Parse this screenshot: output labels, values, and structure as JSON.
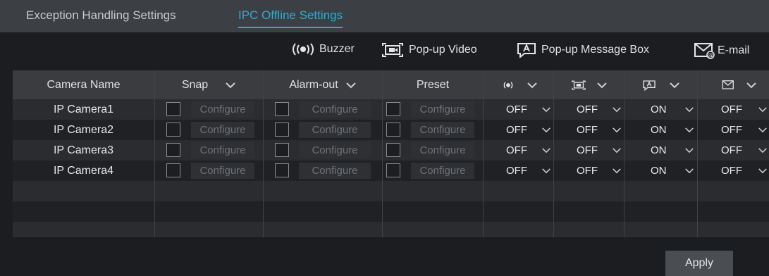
{
  "tabs": [
    {
      "label": "Exception Handling Settings",
      "active": false
    },
    {
      "label": "IPC Offline Settings",
      "active": true
    }
  ],
  "legend": {
    "buzzer": {
      "icon": "buzzer-icon",
      "label": "Buzzer"
    },
    "popup_video": {
      "icon": "popup-video-icon",
      "label": "Pop-up Video"
    },
    "popup_message": {
      "icon": "popup-message-icon",
      "label": "Pop-up Message Box"
    },
    "email": {
      "icon": "email-icon",
      "label": "E-mail"
    }
  },
  "table": {
    "headers": {
      "camera_name": "Camera Name",
      "snap": "Snap",
      "alarm_out": "Alarm-out",
      "preset": "Preset",
      "buzzer_icon": "buzzer-icon",
      "popup_video_icon": "popup-video-icon",
      "popup_message_icon": "popup-message-icon",
      "email_icon": "email-icon"
    },
    "configure_label": "Configure",
    "rows": [
      {
        "name": "IP Camera1",
        "buzzer": "OFF",
        "popup_video": "OFF",
        "popup_message": "ON",
        "email": "OFF"
      },
      {
        "name": "IP Camera2",
        "buzzer": "OFF",
        "popup_video": "OFF",
        "popup_message": "ON",
        "email": "OFF"
      },
      {
        "name": "IP Camera3",
        "buzzer": "OFF",
        "popup_video": "OFF",
        "popup_message": "ON",
        "email": "OFF"
      },
      {
        "name": "IP Camera4",
        "buzzer": "OFF",
        "popup_video": "OFF",
        "popup_message": "ON",
        "email": "OFF"
      }
    ]
  },
  "apply_label": "Apply",
  "colors": {
    "accent": "#27b0d6",
    "background": "#1b1d20",
    "header": "#3a3c40"
  }
}
